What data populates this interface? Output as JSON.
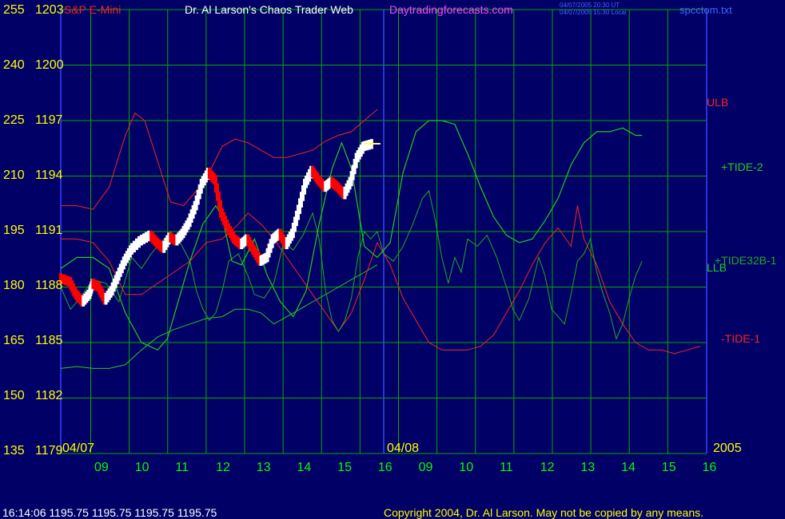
{
  "header": {
    "instrument": "S&P E-Mini",
    "title": "Dr. Al Larson's Chaos Trader Web",
    "site": "Daytradingforecasts.com",
    "time_ut": "04/07/2005 20:30 UT",
    "time_local": "04/07/2005 15:30 Local",
    "file": "spcctom.txt"
  },
  "footer": {
    "quote": "16:14:06  1195.75 1195.75 1195.75 1195.75",
    "copyright": "Copyright 2004, Dr. Al Larson. May not be copied by any means."
  },
  "colors": {
    "background": "#000066",
    "grid": "#00aa00",
    "price_up": "#ffffff",
    "price_down": "#ff0000",
    "ulb_llb": "#ff2222",
    "tide2": "#22cc22",
    "tide32": "#22aa22",
    "tide1": "#ff2222",
    "axis_text": "#ffff00",
    "day_text": "#00ff00"
  },
  "chart_data": {
    "type": "line",
    "left_axis_outer": [
      "255",
      "240",
      "225",
      "210",
      "195",
      "180",
      "165",
      "150",
      "135"
    ],
    "left_axis_inner": [
      "1203",
      "1200",
      "1197",
      "1194",
      "1191",
      "1188",
      "1185",
      "1182",
      "1179"
    ],
    "date_labels": [
      "04/07",
      "04/08",
      "2005"
    ],
    "hour_labels": [
      "09",
      "10",
      "11",
      "12",
      "13",
      "14",
      "15",
      "16",
      "09",
      "10",
      "11",
      "12",
      "13",
      "14",
      "15",
      "16"
    ],
    "series_labels": [
      "ULB",
      "+TIDE-2",
      "+TIDE32B-1",
      "LLB",
      "-TIDE-1"
    ],
    "price_ylim": [
      1179,
      1203
    ],
    "price": [
      [
        0.0,
        1188.5
      ],
      [
        0.3,
        1188.3
      ],
      [
        0.5,
        1187.6
      ],
      [
        0.7,
        1187.2
      ],
      [
        0.9,
        1187.6
      ],
      [
        1.0,
        1188.2
      ],
      [
        1.2,
        1188.0
      ],
      [
        1.4,
        1187.3
      ],
      [
        1.6,
        1187.8
      ],
      [
        1.8,
        1188.6
      ],
      [
        2.0,
        1189.4
      ],
      [
        2.2,
        1190.0
      ],
      [
        2.5,
        1190.5
      ],
      [
        2.8,
        1190.8
      ],
      [
        3.0,
        1190.4
      ],
      [
        3.2,
        1190.1
      ],
      [
        3.4,
        1190.7
      ],
      [
        3.6,
        1190.5
      ],
      [
        3.8,
        1190.9
      ],
      [
        4.0,
        1191.5
      ],
      [
        4.2,
        1192.4
      ],
      [
        4.4,
        1193.6
      ],
      [
        4.6,
        1194.2
      ],
      [
        4.8,
        1193.8
      ],
      [
        5.0,
        1192.0
      ],
      [
        5.2,
        1191.2
      ],
      [
        5.4,
        1190.6
      ],
      [
        5.6,
        1190.3
      ],
      [
        5.8,
        1190.6
      ],
      [
        6.0,
        1190.0
      ],
      [
        6.2,
        1189.4
      ],
      [
        6.4,
        1189.6
      ],
      [
        6.6,
        1190.6
      ],
      [
        6.8,
        1190.9
      ],
      [
        7.0,
        1190.3
      ],
      [
        7.2,
        1190.9
      ],
      [
        7.4,
        1192.2
      ],
      [
        7.6,
        1193.6
      ],
      [
        7.8,
        1194.3
      ],
      [
        8.0,
        1193.8
      ],
      [
        8.2,
        1193.4
      ],
      [
        8.4,
        1193.7
      ],
      [
        8.6,
        1193.4
      ],
      [
        8.8,
        1193.0
      ],
      [
        9.0,
        1193.7
      ],
      [
        9.2,
        1195.0
      ],
      [
        9.4,
        1195.6
      ],
      [
        9.7,
        1195.75
      ]
    ],
    "ulb": [
      [
        0.0,
        1192.4
      ],
      [
        0.5,
        1192.4
      ],
      [
        1.0,
        1192.2
      ],
      [
        1.5,
        1193.4
      ],
      [
        2.0,
        1196.2
      ],
      [
        2.3,
        1197.4
      ],
      [
        2.6,
        1197.0
      ],
      [
        3.0,
        1194.8
      ],
      [
        3.4,
        1192.6
      ],
      [
        3.8,
        1192.4
      ],
      [
        4.2,
        1193.2
      ],
      [
        4.6,
        1194.2
      ],
      [
        5.0,
        1195.6
      ],
      [
        5.4,
        1196.0
      ],
      [
        5.8,
        1195.8
      ],
      [
        6.2,
        1195.4
      ],
      [
        6.6,
        1195.0
      ],
      [
        7.0,
        1195.0
      ],
      [
        7.4,
        1195.2
      ],
      [
        7.8,
        1195.4
      ],
      [
        8.2,
        1195.9
      ],
      [
        8.6,
        1196.2
      ],
      [
        9.0,
        1196.4
      ],
      [
        9.4,
        1197.0
      ],
      [
        9.8,
        1197.6
      ]
    ],
    "llb": [
      [
        0.0,
        1183.6
      ],
      [
        0.5,
        1183.7
      ],
      [
        1.0,
        1183.6
      ],
      [
        1.5,
        1183.6
      ],
      [
        2.0,
        1183.8
      ],
      [
        2.5,
        1184.6
      ],
      [
        3.0,
        1185.3
      ],
      [
        3.5,
        1185.7
      ],
      [
        4.0,
        1186.0
      ],
      [
        4.5,
        1186.3
      ],
      [
        5.0,
        1186.4
      ],
      [
        5.4,
        1186.8
      ],
      [
        5.8,
        1186.8
      ],
      [
        6.2,
        1186.6
      ],
      [
        6.6,
        1186.0
      ],
      [
        7.0,
        1186.4
      ],
      [
        7.4,
        1186.8
      ],
      [
        7.8,
        1187.2
      ],
      [
        8.2,
        1187.6
      ],
      [
        8.6,
        1188.0
      ],
      [
        9.0,
        1188.4
      ],
      [
        9.4,
        1188.8
      ],
      [
        9.8,
        1189.2
      ]
    ],
    "tide2": [
      [
        0.0,
        1189.0
      ],
      [
        0.5,
        1189.6
      ],
      [
        1.0,
        1189.6
      ],
      [
        1.5,
        1189.0
      ],
      [
        2.0,
        1186.6
      ],
      [
        2.5,
        1185.0
      ],
      [
        3.0,
        1184.6
      ],
      [
        3.3,
        1185.2
      ],
      [
        3.6,
        1187.0
      ],
      [
        4.0,
        1189.4
      ],
      [
        4.4,
        1191.4
      ],
      [
        4.8,
        1192.4
      ],
      [
        5.0,
        1191.8
      ],
      [
        5.3,
        1189.4
      ],
      [
        5.6,
        1189.2
      ],
      [
        6.0,
        1190.6
      ],
      [
        6.4,
        1188.6
      ],
      [
        6.8,
        1187.2
      ],
      [
        7.2,
        1186.4
      ],
      [
        7.6,
        1187.8
      ],
      [
        8.0,
        1191.4
      ],
      [
        8.4,
        1194.4
      ],
      [
        8.7,
        1195.8
      ],
      [
        9.0,
        1194.4
      ],
      [
        9.4,
        1190.2
      ],
      [
        9.8,
        1189.6
      ],
      [
        10.2,
        1190.4
      ],
      [
        10.6,
        1194.2
      ],
      [
        11.0,
        1196.4
      ],
      [
        11.4,
        1197.0
      ],
      [
        11.8,
        1197.0
      ],
      [
        12.2,
        1196.8
      ],
      [
        12.6,
        1195.2
      ],
      [
        13.0,
        1193.4
      ],
      [
        13.4,
        1191.8
      ],
      [
        13.8,
        1190.8
      ],
      [
        14.2,
        1190.4
      ],
      [
        14.6,
        1190.6
      ],
      [
        15.0,
        1191.6
      ],
      [
        15.4,
        1192.8
      ],
      [
        15.8,
        1194.6
      ],
      [
        16.2,
        1195.8
      ],
      [
        16.6,
        1196.4
      ],
      [
        17.0,
        1196.4
      ],
      [
        17.4,
        1196.6
      ],
      [
        17.8,
        1196.2
      ],
      [
        18.0,
        1196.2
      ]
    ],
    "tide32": [
      [
        0.0,
        1188.0
      ],
      [
        0.3,
        1186.8
      ],
      [
        0.6,
        1187.4
      ],
      [
        1.0,
        1188.4
      ],
      [
        1.4,
        1188.2
      ],
      [
        1.8,
        1187.2
      ],
      [
        2.2,
        1189.6
      ],
      [
        2.5,
        1189.0
      ],
      [
        2.8,
        1189.8
      ],
      [
        3.1,
        1190.4
      ],
      [
        3.4,
        1191.0
      ],
      [
        3.7,
        1190.4
      ],
      [
        4.0,
        1189.4
      ],
      [
        4.2,
        1187.8
      ],
      [
        4.4,
        1186.8
      ],
      [
        4.6,
        1186.2
      ],
      [
        4.8,
        1186.6
      ],
      [
        5.0,
        1187.8
      ],
      [
        5.2,
        1189.4
      ],
      [
        5.5,
        1189.8
      ],
      [
        5.8,
        1188.6
      ],
      [
        6.0,
        1187.6
      ],
      [
        6.3,
        1187.4
      ],
      [
        6.6,
        1188.2
      ],
      [
        6.9,
        1190.4
      ],
      [
        7.2,
        1190.0
      ],
      [
        7.5,
        1190.8
      ],
      [
        7.8,
        1192.0
      ],
      [
        8.0,
        1190.6
      ],
      [
        8.2,
        1187.8
      ],
      [
        8.4,
        1186.2
      ],
      [
        8.6,
        1185.6
      ],
      [
        8.8,
        1186.2
      ],
      [
        9.0,
        1187.4
      ],
      [
        9.2,
        1189.6
      ],
      [
        9.4,
        1191.0
      ],
      [
        9.6,
        1190.6
      ],
      [
        9.8,
        1191.0
      ],
      [
        10.0,
        1189.8
      ],
      [
        10.3,
        1189.4
      ],
      [
        10.6,
        1190.2
      ],
      [
        10.9,
        1191.4
      ],
      [
        11.2,
        1192.8
      ],
      [
        11.4,
        1193.2
      ],
      [
        11.6,
        1191.6
      ],
      [
        11.8,
        1189.6
      ],
      [
        12.0,
        1188.2
      ],
      [
        12.2,
        1189.6
      ],
      [
        12.4,
        1188.8
      ],
      [
        12.6,
        1190.6
      ],
      [
        12.9,
        1190.2
      ],
      [
        13.2,
        1190.8
      ],
      [
        13.5,
        1189.6
      ],
      [
        13.8,
        1188.0
      ],
      [
        14.0,
        1186.8
      ],
      [
        14.2,
        1186.2
      ],
      [
        14.5,
        1187.4
      ],
      [
        14.8,
        1189.6
      ],
      [
        15.0,
        1188.6
      ],
      [
        15.2,
        1186.8
      ],
      [
        15.4,
        1186.4
      ],
      [
        15.6,
        1186.0
      ],
      [
        15.8,
        1187.6
      ],
      [
        16.0,
        1189.4
      ],
      [
        16.2,
        1189.8
      ],
      [
        16.4,
        1190.6
      ],
      [
        16.6,
        1188.8
      ],
      [
        16.8,
        1187.6
      ],
      [
        17.0,
        1186.6
      ],
      [
        17.2,
        1185.2
      ],
      [
        17.4,
        1186.0
      ],
      [
        17.6,
        1187.4
      ],
      [
        17.8,
        1188.6
      ],
      [
        18.0,
        1189.4
      ]
    ],
    "tide1": [
      [
        0.0,
        1190.6
      ],
      [
        0.5,
        1190.6
      ],
      [
        1.0,
        1190.4
      ],
      [
        1.5,
        1189.4
      ],
      [
        2.0,
        1187.6
      ],
      [
        2.5,
        1187.6
      ],
      [
        3.0,
        1188.2
      ],
      [
        3.5,
        1188.8
      ],
      [
        4.0,
        1189.4
      ],
      [
        4.5,
        1190.4
      ],
      [
        5.0,
        1190.6
      ],
      [
        5.5,
        1191.4
      ],
      [
        5.8,
        1192.0
      ],
      [
        6.2,
        1191.4
      ],
      [
        6.6,
        1190.6
      ],
      [
        7.0,
        1189.6
      ],
      [
        7.4,
        1188.6
      ],
      [
        7.8,
        1187.6
      ],
      [
        8.2,
        1186.6
      ],
      [
        8.6,
        1185.6
      ],
      [
        9.0,
        1186.6
      ],
      [
        9.4,
        1188.4
      ],
      [
        9.8,
        1190.4
      ],
      [
        10.2,
        1189.2
      ],
      [
        10.6,
        1187.4
      ],
      [
        11.0,
        1186.2
      ],
      [
        11.4,
        1185.0
      ],
      [
        11.8,
        1184.6
      ],
      [
        12.2,
        1184.6
      ],
      [
        12.6,
        1184.6
      ],
      [
        13.0,
        1184.8
      ],
      [
        13.4,
        1185.4
      ],
      [
        13.8,
        1186.6
      ],
      [
        14.2,
        1187.8
      ],
      [
        14.6,
        1189.2
      ],
      [
        15.0,
        1190.4
      ],
      [
        15.4,
        1191.2
      ],
      [
        15.8,
        1190.2
      ],
      [
        16.0,
        1192.4
      ],
      [
        16.2,
        1190.6
      ],
      [
        16.6,
        1189.2
      ],
      [
        17.0,
        1187.2
      ],
      [
        17.4,
        1186.0
      ],
      [
        17.8,
        1185.0
      ],
      [
        18.2,
        1184.6
      ],
      [
        18.6,
        1184.6
      ],
      [
        19.0,
        1184.4
      ],
      [
        19.4,
        1184.6
      ],
      [
        19.8,
        1184.8
      ]
    ]
  }
}
